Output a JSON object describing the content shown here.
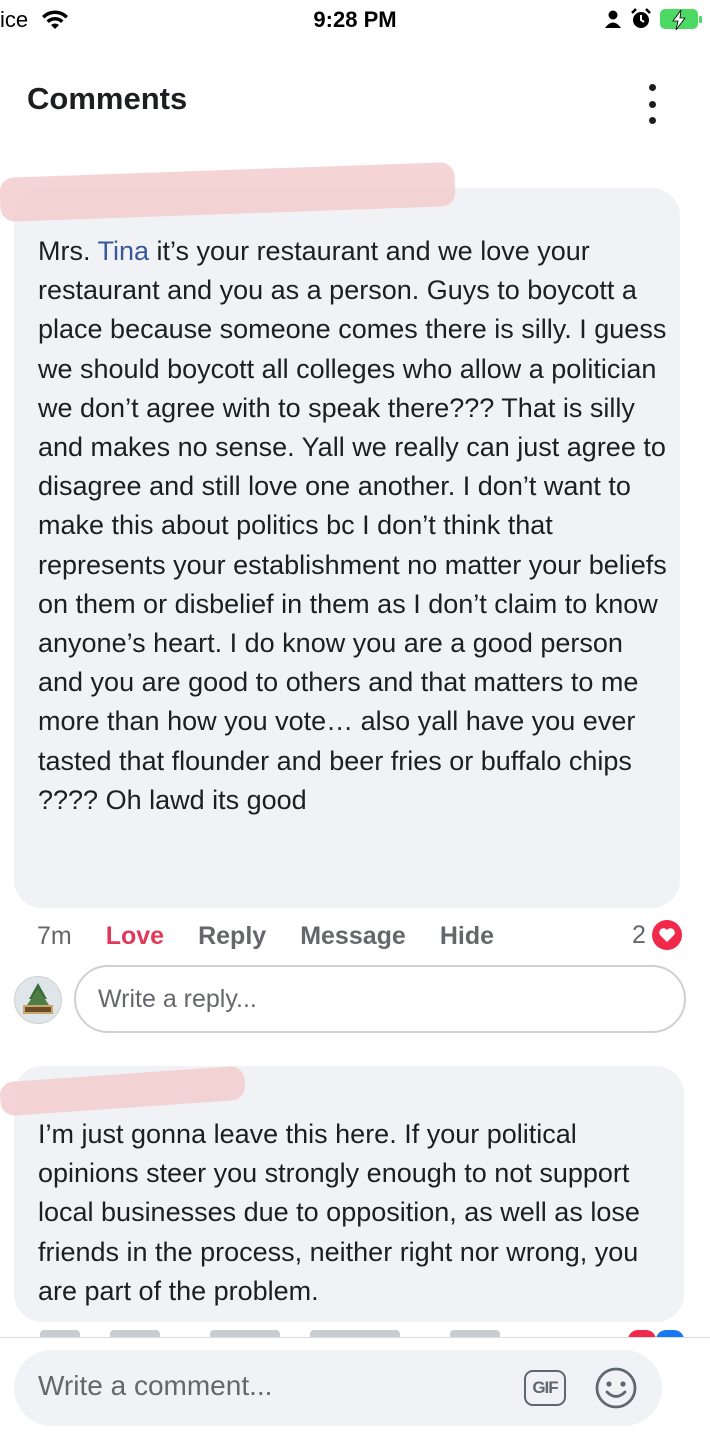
{
  "status_bar": {
    "carrier": "ice",
    "time": "9:28 PM",
    "icons": [
      "wifi-icon",
      "person-icon",
      "alarm-icon",
      "battery-charging-icon"
    ],
    "battery_color": "#4cd964"
  },
  "header": {
    "title": "Comments",
    "menu_icon": "more-vertical-icon"
  },
  "comments": [
    {
      "mention": "Tina",
      "text_before": "Mrs. ",
      "text_after": " it’s your restaurant and we love your restaurant and you as a person. Guys to boycott a place because someone comes there is silly. I guess we should boycott all colleges who allow a politician we don’t agree with to speak there??? That is silly and makes no sense. Yall we really can just agree to disagree and still love one another. I don’t want to make this about politics bc I don’t think that represents your establishment no matter your beliefs on them or disbelief in them as I don’t claim to know anyone’s heart. I do know you are a good person and you are good to others and that matters to me more than how you vote… also yall have you ever tasted that flounder and beer fries or buffalo chips ???? Oh lawd its good",
      "time": "7m",
      "actions": [
        "Love",
        "Reply",
        "Message",
        "Hide"
      ],
      "reaction_count": "2",
      "reaction_icon": "heart-icon"
    },
    {
      "text": "I’m just gonna leave this here. If your political opinions steer you strongly enough to not support local businesses due to opposition, as well as lose friends in the process, neither right nor wrong, you are part of the problem."
    }
  ],
  "reply_box": {
    "placeholder": "Write a reply..."
  },
  "composer": {
    "placeholder": "Write a comment...",
    "gif_label": "GIF",
    "emoji_icon": "smiley-icon"
  },
  "colors": {
    "bubble": "#f0f2f5",
    "love_accent": "#e0395a",
    "mention": "#385898",
    "secondary_text": "#65676b"
  }
}
